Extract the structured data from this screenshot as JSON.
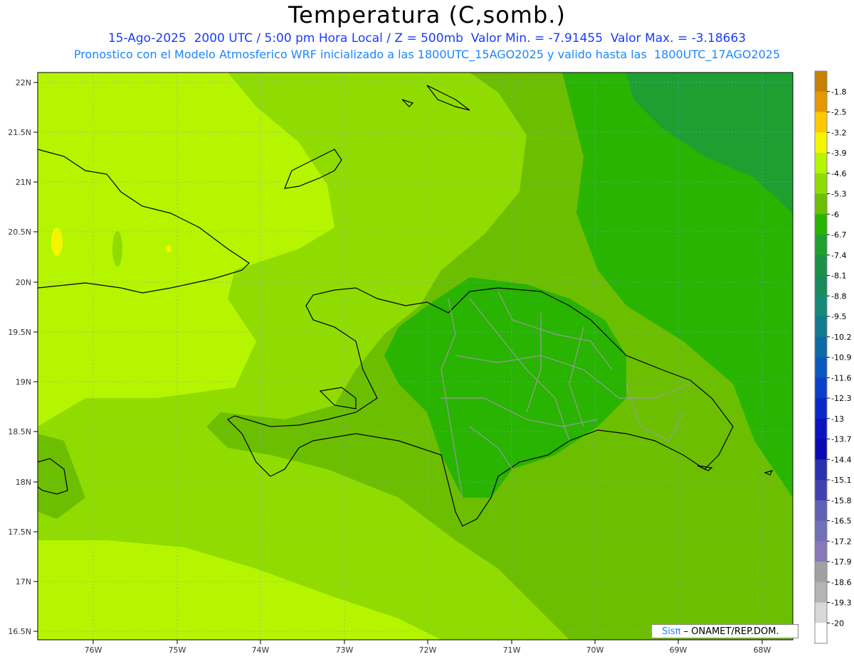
{
  "header": {
    "title": "Temperatura (C,somb.)",
    "line1": "15-Ago-2025  2000 UTC / 5:00 pm Hora Local / Z = 500mb  Valor Min. = -7.91455  Valor Max. = -3.18663",
    "line2": "Pronostico con el Modelo Atmosferico WRF inicializado a las 1800UTC_15AGO2025 y valido hasta las  1800UTC_17AGO2025"
  },
  "axes": {
    "lat_labels": [
      "22N",
      "21.5N",
      "21N",
      "20.5N",
      "20N",
      "19.5N",
      "19N",
      "18.5N",
      "18N",
      "17.5N",
      "17N",
      "16.5N"
    ],
    "lon_labels": [
      "76W",
      "75W",
      "74W",
      "73W",
      "72W",
      "71W",
      "70W",
      "69W",
      "68W"
    ]
  },
  "colorbar": {
    "labels": [
      "-1.8",
      "-2.5",
      "-3.2",
      "-3.9",
      "-4.6",
      "-5.3",
      "-6",
      "-6.7",
      "-7.4",
      "-8.1",
      "-8.8",
      "-9.5",
      "-10.2",
      "-10.9",
      "-11.6",
      "-12.3",
      "-13",
      "-13.7",
      "-14.4",
      "-15.1",
      "-15.8",
      "-16.5",
      "-17.2",
      "-17.9",
      "-18.6",
      "-19.3",
      "-20"
    ],
    "colors": [
      "#c78000",
      "#e69800",
      "#ffc800",
      "#f5f500",
      "#b5f500",
      "#90dc00",
      "#6cbf00",
      "#28b400",
      "#1ea030",
      "#1b9046",
      "#198a5a",
      "#158a78",
      "#117a8c",
      "#0d6aa5",
      "#0a58c0",
      "#0a40c8",
      "#0a28c8",
      "#0a14c0",
      "#0a0ab4",
      "#2830b0",
      "#4040b0",
      "#6060b4",
      "#7070b8",
      "#8878b8",
      "#a0a0a0",
      "#b4b4b4",
      "#d8d8d8",
      "#ffffff"
    ]
  },
  "credit": {
    "brand": "Sisπ",
    "text": " –  ONAMET/REP.DOM."
  }
}
